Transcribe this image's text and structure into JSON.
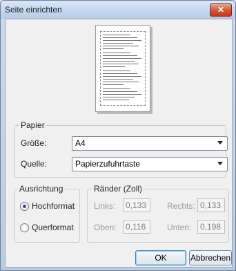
{
  "window": {
    "title": "Seite einrichten",
    "close_glyph": "✕"
  },
  "paper": {
    "group_label": "Papier",
    "size_label": "Größe:",
    "size_value": "A4",
    "source_label": "Quelle:",
    "source_value": "Papierzufuhrtaste"
  },
  "orientation": {
    "group_label": "Ausrichtung",
    "portrait_label": "Hochformat",
    "landscape_label": "Querformat",
    "selected": "Hochformat"
  },
  "margins": {
    "group_label": "Ränder (Zoll)",
    "left_label": "Links:",
    "left_value": "0,133",
    "right_label": "Rechts:",
    "right_value": "0,133",
    "top_label": "Oben:",
    "top_value": "0,116",
    "bottom_label": "Unten:",
    "bottom_value": "0,198"
  },
  "buttons": {
    "ok": "OK",
    "cancel": "Abbrechen"
  }
}
